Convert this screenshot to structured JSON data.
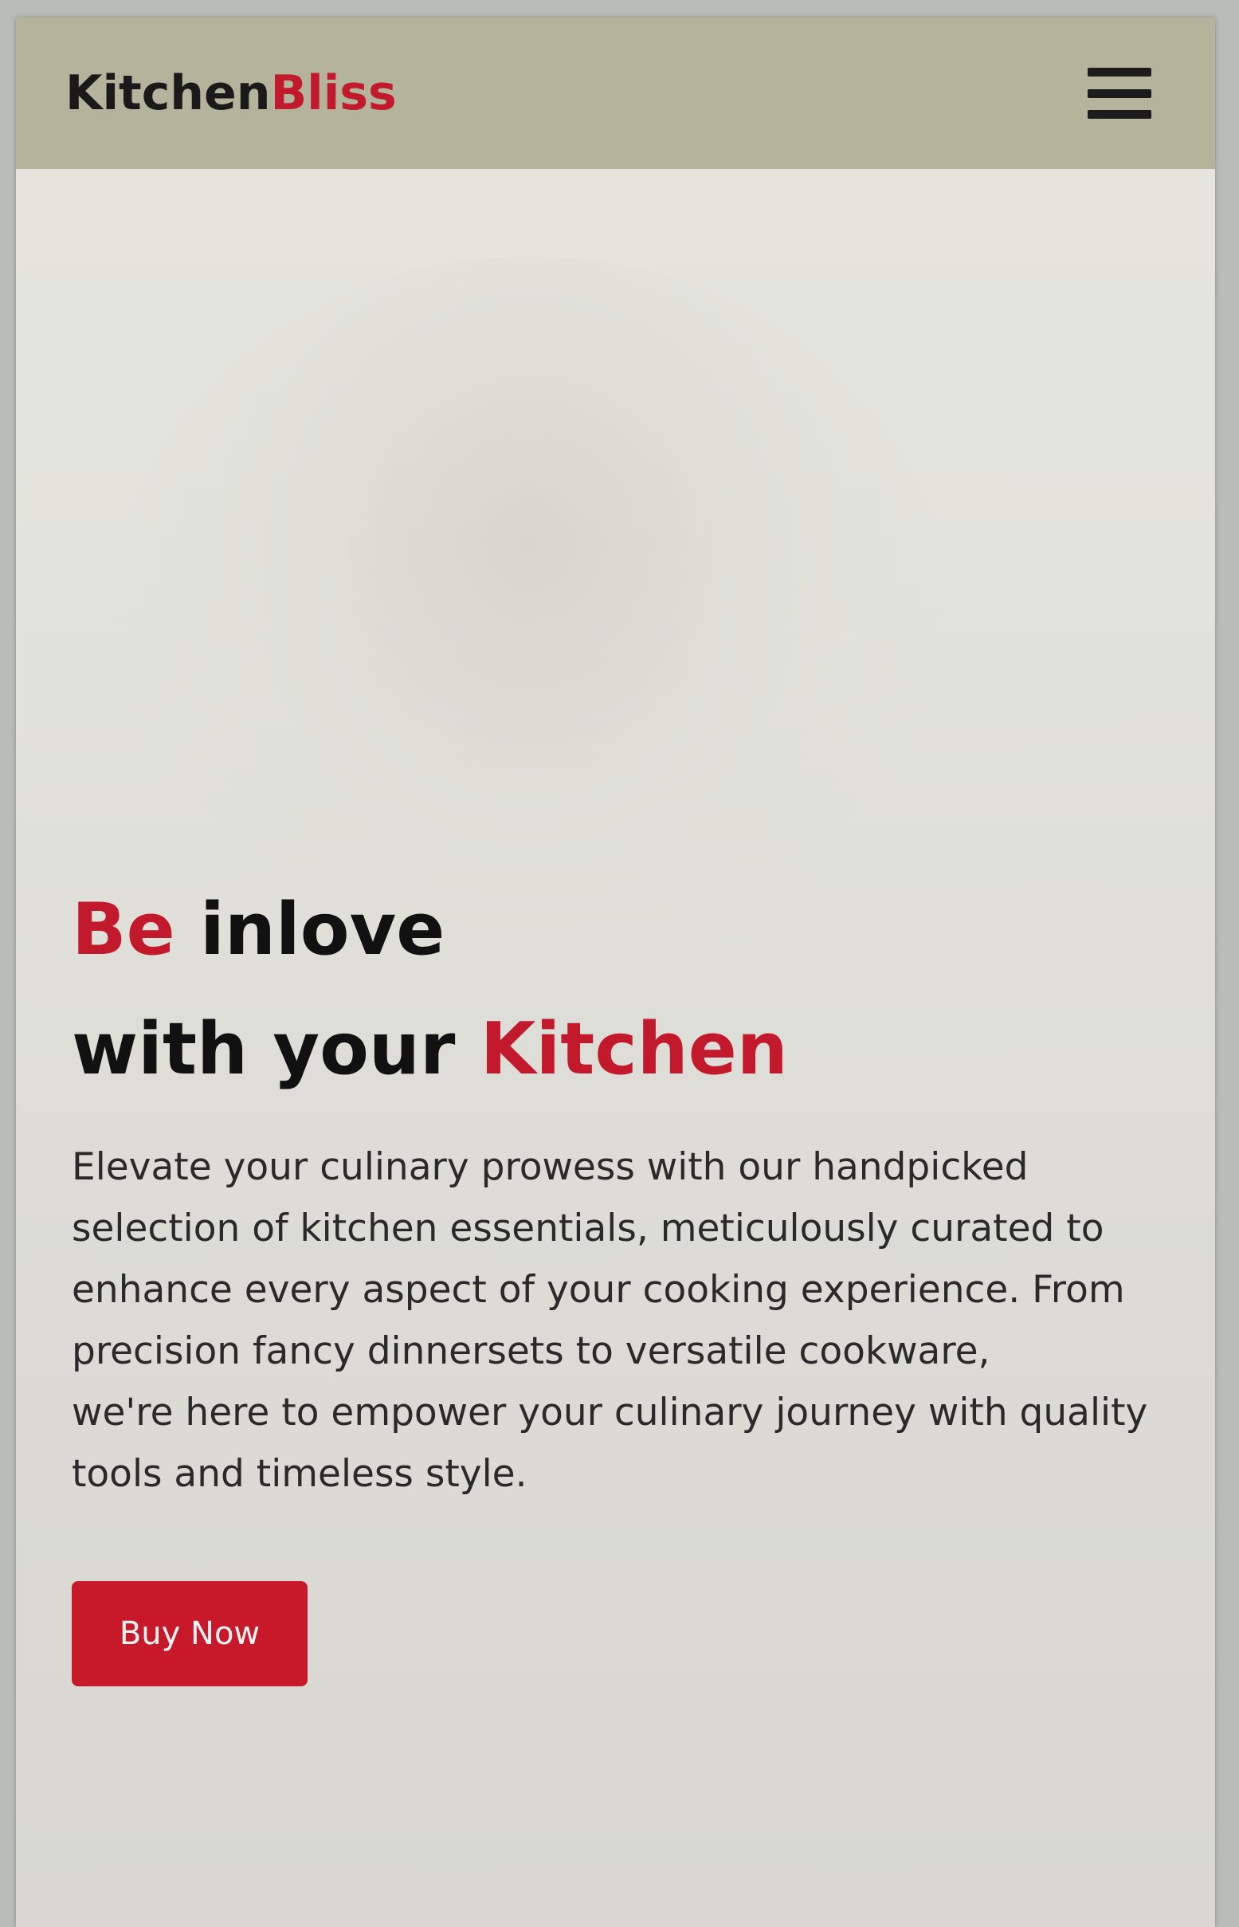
{
  "navbar": {
    "logo_main": "Kitchen",
    "logo_accent": "Bliss",
    "menu_icon": "hamburger-menu-icon"
  },
  "hero": {
    "headline_line1_accent": "Be",
    "headline_line1_rest": " inlove",
    "headline_line2_start": "with your ",
    "headline_line2_accent": "Kitchen",
    "description_part1": "Elevate your culinary prowess with our handpicked selection of kitchen essentials, meticulously curated to enhance every aspect of your cooking experience. From precision fancy dinnersets to versatile cookware,",
    "description_part2": "we're here to empower your culinary journey with quality tools and timeless style.",
    "cta_label": "Buy Now"
  },
  "colors": {
    "accent": "#c21a2c",
    "navbar_bg": "#b4b39c",
    "page_bg": "#e3e3dd",
    "text": "#111111"
  }
}
